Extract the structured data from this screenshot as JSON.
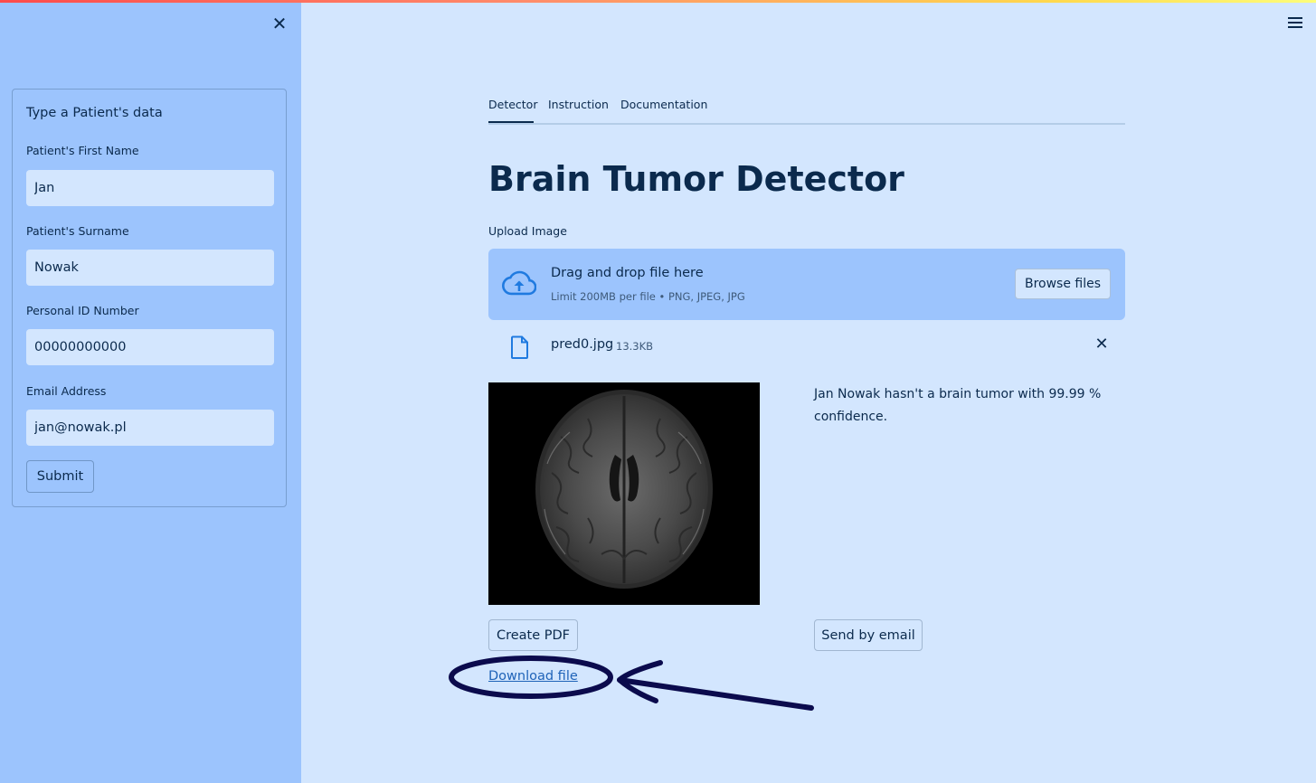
{
  "sidebar": {
    "form_title": "Type a Patient's data",
    "fields": [
      {
        "label": "Patient's First Name",
        "value": "Jan"
      },
      {
        "label": "Patient's Surname",
        "value": "Nowak"
      },
      {
        "label": "Personal ID Number",
        "value": "00000000000"
      },
      {
        "label": "Email Address",
        "value": "jan@nowak.pl"
      }
    ],
    "submit_label": "Submit",
    "close_icon": "close-icon"
  },
  "header": {
    "menu_icon": "hamburger-menu-icon"
  },
  "tabs": [
    {
      "label": "Detector",
      "active": true
    },
    {
      "label": "Instruction",
      "active": false
    },
    {
      "label": "Documentation",
      "active": false
    }
  ],
  "main": {
    "title": "Brain Tumor Detector",
    "upload_label": "Upload Image",
    "dropzone": {
      "main_text": "Drag and drop file here",
      "sub_text": "Limit 200MB per file • PNG, JPEG, JPG",
      "browse_label": "Browse files"
    },
    "file": {
      "name": "pred0.jpg",
      "size": "13.3KB"
    },
    "result": "Jan Nowak hasn't a brain tumor with 99.99 % confidence.",
    "create_pdf_label": "Create PDF",
    "send_email_label": "Send by email",
    "download_label": "Download file"
  },
  "colors": {
    "sidebar_bg": "#9cc4fd",
    "main_bg": "#d3e6fe",
    "text": "#0b2a4d",
    "icon_accent": "#1f7ae0",
    "annotation": "#0b0b4d"
  }
}
